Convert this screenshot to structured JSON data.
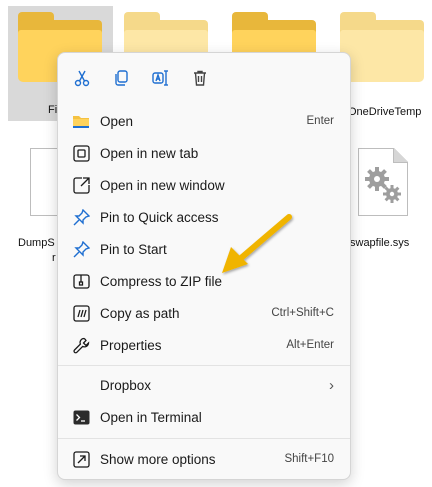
{
  "explorer": {
    "files_row2": {
      "dump_label": "DumpS",
      "dump_label2": "r",
      "swap_label": "swapfile.sys"
    },
    "files_row1": {
      "selected_label": "Fi",
      "onedrive_label": "OneDriveTemp"
    }
  },
  "menu": {
    "toolbar": [
      "scissors-icon",
      "copy-icon",
      "rename-icon",
      "trash-icon"
    ],
    "items": [
      {
        "label": "Open",
        "shortcut": "Enter",
        "icon": "folder-icon"
      },
      {
        "label": "Open in new tab",
        "shortcut": "",
        "icon": "new-tab-icon"
      },
      {
        "label": "Open in new window",
        "shortcut": "",
        "icon": "new-window-icon"
      },
      {
        "label": "Pin to Quick access",
        "shortcut": "",
        "icon": "pin-icon"
      },
      {
        "label": "Pin to Start",
        "shortcut": "",
        "icon": "pin-icon"
      },
      {
        "label": "Compress to ZIP file",
        "shortcut": "",
        "icon": "zip-icon"
      },
      {
        "label": "Copy as path",
        "shortcut": "Ctrl+Shift+C",
        "icon": "copy-path-icon"
      },
      {
        "label": "Properties",
        "shortcut": "Alt+Enter",
        "icon": "wrench-icon"
      }
    ],
    "dropbox": {
      "label": "Dropbox",
      "submenu": "›"
    },
    "terminal": {
      "label": "Open in Terminal"
    },
    "more": {
      "label": "Show more options",
      "shortcut": "Shift+F10"
    }
  },
  "colors": {
    "folder_back": "#f2c94c",
    "folder_front": "#ffd966",
    "accent": "#0a64c2",
    "arrow": "#f0b400"
  }
}
